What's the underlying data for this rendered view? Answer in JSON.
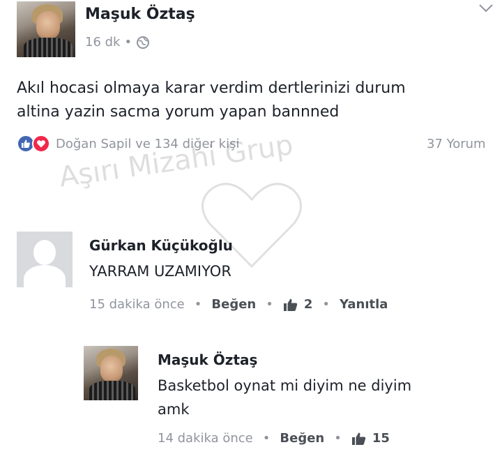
{
  "post": {
    "author": "Maşuk Öztaş",
    "time": "16 dk",
    "separator": "•",
    "text_line1": "Akıl hocasi olmaya karar verdim dertlerinizi  durum",
    "text_line2": "altina yazin sacma yorum yapan bannned",
    "reactions_text": "Doğan Sapil ve 134 diğer kişi",
    "comment_count": "37 Yorum"
  },
  "watermark": {
    "text": "Aşırı Mizahi Grup"
  },
  "comments": [
    {
      "author": "Gürkan Küçükoğlu",
      "text": "YARRAM UZAMIYOR",
      "time": "15 dakika önce",
      "like_label": "Beğen",
      "like_count": "2",
      "reply_label": "Yanıtla"
    },
    {
      "author": "Maşuk Öztaş",
      "text_line1": "Basketbol oynat mi diyim ne diyim",
      "text_line2": "amk",
      "time": "14 dakika önce",
      "like_label": "Beğen",
      "like_count": "15"
    }
  ],
  "colors": {
    "like_blue": "#4267b2",
    "love_red": "#f0284a",
    "meta_gray": "#90949c"
  },
  "icons": [
    "globe-icon",
    "chevron-down-icon",
    "like-reaction-icon",
    "love-reaction-icon",
    "thumbs-up-icon",
    "heart-watermark-icon"
  ]
}
